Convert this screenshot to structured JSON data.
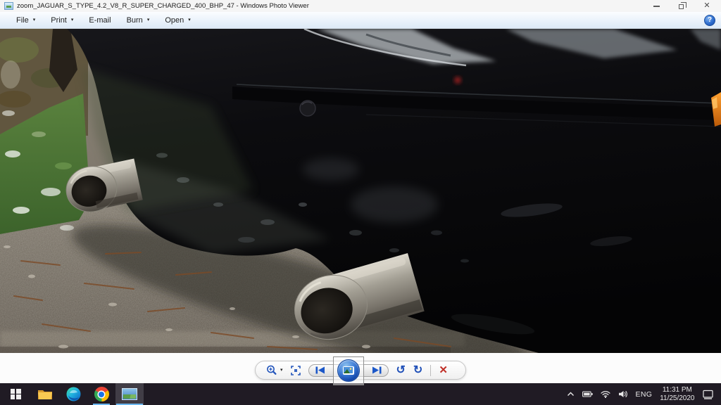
{
  "window": {
    "title": "zoom_JAGUAR_S_TYPE_4.2_V8_R_SUPER_CHARGED_400_BHP_47 - Windows Photo Viewer",
    "close_glyph": "✕"
  },
  "menubar": {
    "dropdown_glyph": "▾",
    "help_glyph": "?",
    "items": [
      {
        "label": "File",
        "dropdown": true
      },
      {
        "label": "Print",
        "dropdown": true
      },
      {
        "label": "E-mail",
        "dropdown": false
      },
      {
        "label": "Burn",
        "dropdown": true
      },
      {
        "label": "Open",
        "dropdown": true
      }
    ]
  },
  "photo": {
    "subject": "Rear corner of a black car with twin stainless-steel exhaust tips, parked on wet gravel beside frost-dusted grass and a stone wall; orange side marker at right edge"
  },
  "toolbar": {
    "zoom_icon": "magnifier-plus",
    "fit_icon": "actual-size",
    "previous_icon": "previous-frame",
    "slideshow_icon": "play-slideshow",
    "next_icon": "next-frame",
    "rotate_ccw_glyph": "↺",
    "rotate_cw_glyph": "↻",
    "delete_glyph": "✕"
  },
  "taskbar": {
    "apps": [
      {
        "name": "file-explorer",
        "running": false,
        "active": false
      },
      {
        "name": "microsoft-edge",
        "running": false,
        "active": false
      },
      {
        "name": "google-chrome",
        "running": true,
        "active": false
      },
      {
        "name": "windows-photo-viewer",
        "running": true,
        "active": true
      }
    ],
    "tray": {
      "language": "ENG",
      "time": "11:31 PM",
      "date": "11/25/2020"
    },
    "accent_underline": "#6cb8f0"
  }
}
